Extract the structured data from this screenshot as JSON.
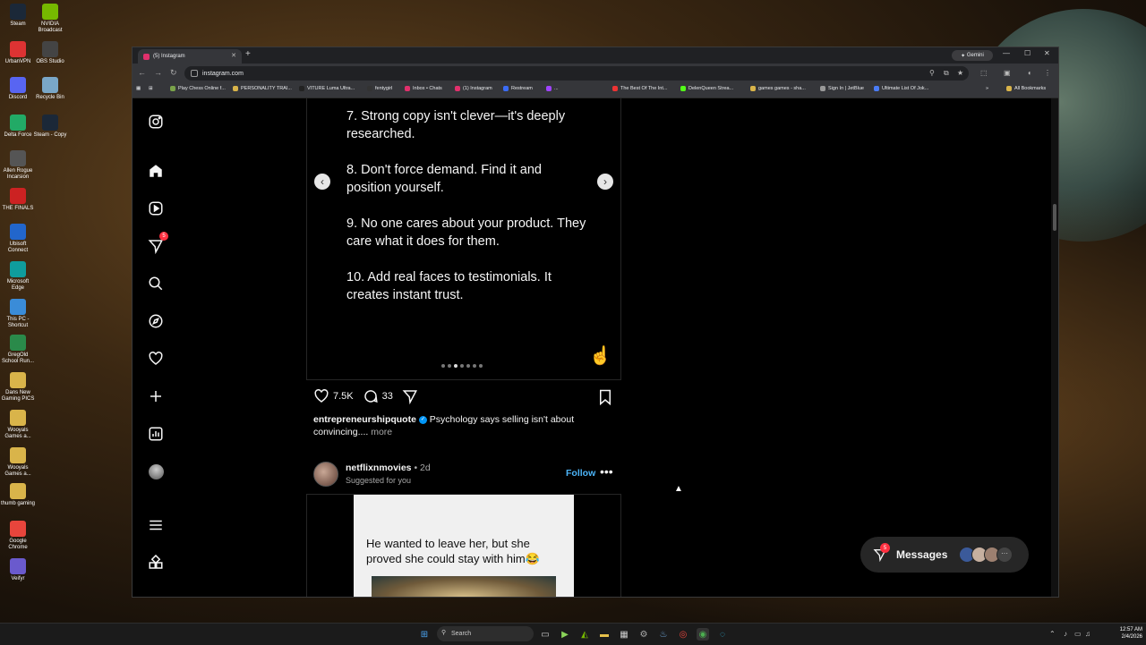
{
  "desktop": {
    "icons": [
      {
        "label": "Steam",
        "color": "#1b2838"
      },
      {
        "label": "NVIDIA Broadcast",
        "color": "#76b900"
      },
      {
        "label": "UrbanVPN",
        "color": "#d33"
      },
      {
        "label": "OBS Studio",
        "color": "#444"
      },
      {
        "label": "Discord",
        "color": "#5865f2"
      },
      {
        "label": "Recycle Bin",
        "color": "#7aa7c7"
      },
      {
        "label": "Delta Force",
        "color": "#2a6"
      },
      {
        "label": "Steam - Copy",
        "color": "#1b2838"
      },
      {
        "label": "Allen Rogue Incarsion",
        "color": "#555"
      },
      {
        "label": "THE FINALS",
        "color": "#c22"
      },
      {
        "label": "Ubisoft Connect",
        "color": "#2266cc"
      },
      {
        "label": "Microsoft Edge",
        "color": "#0f9d9d"
      },
      {
        "label": "This PC - Shortcut",
        "color": "#3a8cd8"
      },
      {
        "label": "GregOld School Run...",
        "color": "#2a8a4a"
      },
      {
        "label": "Dans New Gaming PICS",
        "color": "#d9b44a"
      },
      {
        "label": "Wooyals Games a...",
        "color": "#d9b44a"
      },
      {
        "label": "Wooyals Games a...",
        "color": "#d9b44a"
      },
      {
        "label": "thumb gaming",
        "color": "#d9b44a"
      },
      {
        "label": "Google Chrome",
        "color": "#e8453c"
      },
      {
        "label": "Veifyr",
        "color": "#6a5acd"
      }
    ]
  },
  "browser": {
    "tab_title": "(5) Instagram",
    "gemini_label": "Gemini",
    "url": "instagram.com",
    "bookmarks": [
      {
        "label": "Play Chess Online f...",
        "color": "#7aa34a"
      },
      {
        "label": "PERSONALITY TRAI...",
        "color": "#d9b44a"
      },
      {
        "label": "VITURE Luma Ultra...",
        "color": "#222"
      },
      {
        "label": "fentygirl",
        "color": "#333"
      },
      {
        "label": "Inbox • Chats",
        "color": "#e1306c"
      },
      {
        "label": "(1) Instagram",
        "color": "#e1306c"
      },
      {
        "label": "Restream",
        "color": "#3b6cf6"
      },
      {
        "label": "...",
        "color": "#a044ff"
      },
      {
        "label": "The Best Of The Int...",
        "color": "#e33"
      },
      {
        "label": "DelenQueen Strea...",
        "color": "#53fc18"
      },
      {
        "label": "games games - sha...",
        "color": "#d9b44a"
      },
      {
        "label": "Sign In | JetBlue",
        "color": "#999"
      },
      {
        "label": "Ultimate List Of Jok...",
        "color": "#4a7cf6"
      }
    ],
    "all_bookmarks": "All Bookmarks"
  },
  "sidebar": {
    "notification_count": "5"
  },
  "post1": {
    "slide_lines": [
      "7. Strong copy isn't clever—it's deeply researched.",
      "8. Don't force demand. Find it and position yourself.",
      "9. No one cares about your product. They care what it does for them.",
      "10. Add real faces to testimonials. It creates instant trust."
    ],
    "likes": "7.5K",
    "comments": "33",
    "username": "entrepreneurshipquote",
    "caption": "Psychology says selling isn't about convincing....",
    "more": "more",
    "carousel": {
      "count": 7,
      "active": 2
    }
  },
  "post2": {
    "username": "netflixnmovies",
    "age": "• 2d",
    "suggested": "Suggested for you",
    "follow": "Follow",
    "meme_text": "He wanted to leave her, but she proved she could stay with him😂"
  },
  "messages": {
    "label": "Messages",
    "badge": "5"
  },
  "taskbar": {
    "search_placeholder": "Search",
    "time": "12:57 AM",
    "date": "2/4/2026"
  }
}
